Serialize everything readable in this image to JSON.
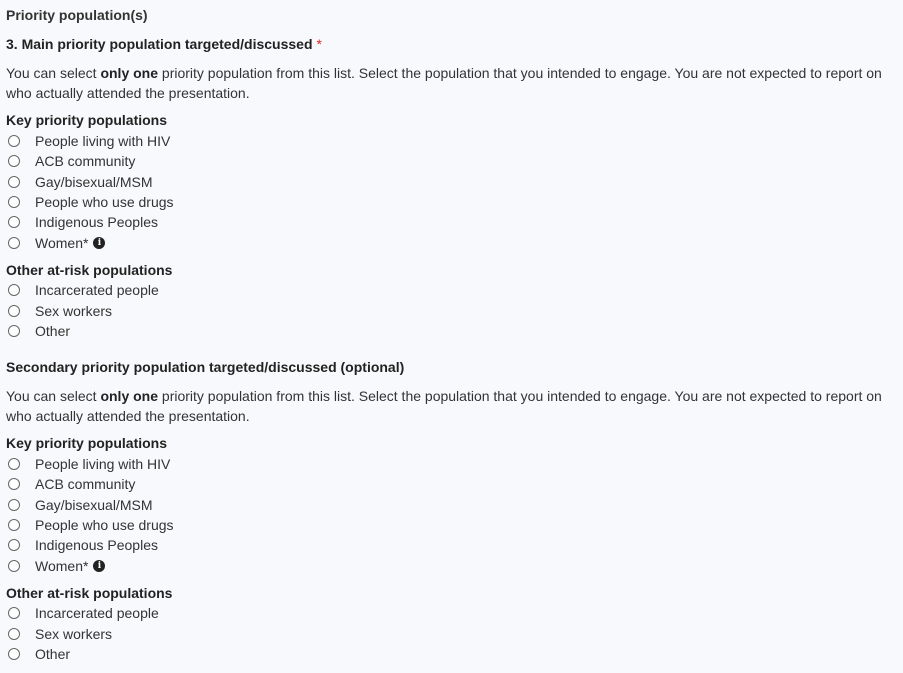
{
  "section_title": "Priority population(s)",
  "questions": [
    {
      "title": "3. Main priority population targeted/discussed",
      "required_marker": "*",
      "desc_pre": "You can select ",
      "desc_bold": "only one",
      "desc_post": " priority population from this list. Select the population that you intended to engage. You are not expected to report on who actually attended the presentation.",
      "groups": [
        {
          "label": "Key priority populations",
          "options": [
            "People living with HIV",
            "ACB community",
            "Gay/bisexual/MSM",
            "People who use drugs",
            "Indigenous Peoples",
            "Women*"
          ]
        },
        {
          "label": "Other at-risk populations",
          "options": [
            "Incarcerated people",
            "Sex workers",
            "Other"
          ]
        }
      ]
    },
    {
      "title": "Secondary priority population targeted/discussed (optional)",
      "desc_pre": "You can select ",
      "desc_bold": "only one",
      "desc_post": " priority population from this list. Select the population that you intended to engage. You are not expected to report on who actually attended the presentation.",
      "groups": [
        {
          "label": "Key priority populations",
          "options": [
            "People living with HIV",
            "ACB community",
            "Gay/bisexual/MSM",
            "People who use drugs",
            "Indigenous Peoples",
            "Women*"
          ]
        },
        {
          "label": "Other at-risk populations",
          "options": [
            "Incarcerated people",
            "Sex workers",
            "Other"
          ]
        }
      ]
    }
  ],
  "info_icon_glyph": "i"
}
